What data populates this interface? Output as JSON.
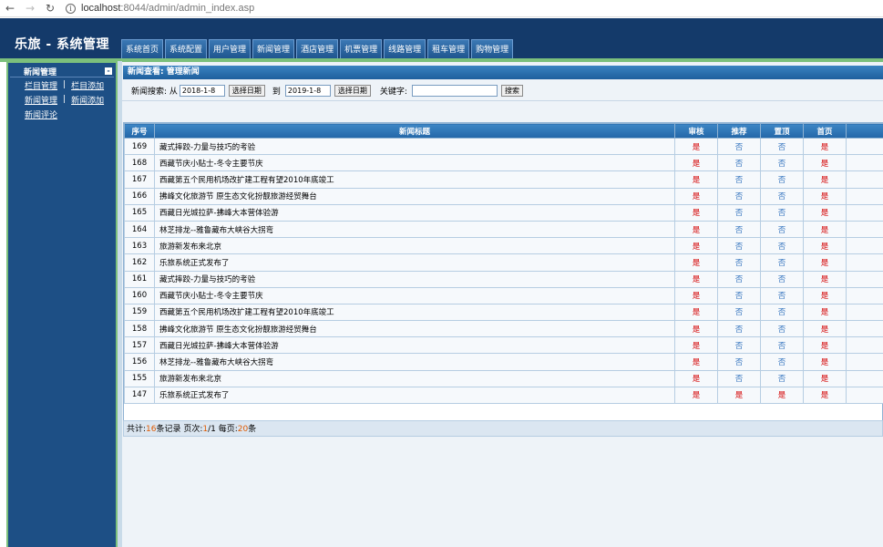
{
  "browser": {
    "url_host": "localhost",
    "url_rest": ":8044/admin/admin_index.asp"
  },
  "app": {
    "title": "乐旅 - 系统管理"
  },
  "menu": [
    "系统首页",
    "系统配置",
    "用户管理",
    "新闻管理",
    "酒店管理",
    "机票管理",
    "线路管理",
    "租车管理",
    "购物管理"
  ],
  "sidebar": {
    "section_title": "新闻管理",
    "collapse_symbol": "-",
    "rows": [
      [
        "栏目管理",
        "栏目添加"
      ],
      [
        "新闻管理",
        "新闻添加"
      ],
      [
        "新闻评论"
      ]
    ],
    "separator": "|"
  },
  "panel": {
    "title": "新闻查看: 管理新闻"
  },
  "search": {
    "label_prefix": "新闻搜索: 从",
    "date_from": "2018-1-8",
    "pick_date_label": "选择日期",
    "to_label": "到",
    "date_to": "2019-1-8",
    "keyword_label": "关键字:",
    "keyword_value": "",
    "search_button": "搜索"
  },
  "table": {
    "headers": [
      "序号",
      "新闻标题",
      "审核",
      "推荐",
      "置顶",
      "首页"
    ],
    "rows": [
      {
        "id": "169",
        "title": "藏式摔跤-力量与技巧的考验",
        "audit": "是",
        "recommend": "否",
        "top": "否",
        "home": "是"
      },
      {
        "id": "168",
        "title": "西藏节庆小贴士-冬令主要节庆",
        "audit": "是",
        "recommend": "否",
        "top": "否",
        "home": "是"
      },
      {
        "id": "167",
        "title": "西藏第五个民用机场改扩建工程有望2010年底竣工",
        "audit": "是",
        "recommend": "否",
        "top": "否",
        "home": "是"
      },
      {
        "id": "166",
        "title": "拂峰文化旅游节 原生态文化扮靓旅游经贸舞台",
        "audit": "是",
        "recommend": "否",
        "top": "否",
        "home": "是"
      },
      {
        "id": "165",
        "title": "西藏日光城拉萨-拂峰大本营体验游",
        "audit": "是",
        "recommend": "否",
        "top": "否",
        "home": "是"
      },
      {
        "id": "164",
        "title": "林芝排龙--雅鲁藏布大峡谷大拐弯",
        "audit": "是",
        "recommend": "否",
        "top": "否",
        "home": "是"
      },
      {
        "id": "163",
        "title": "旅游新发布来北京",
        "audit": "是",
        "recommend": "否",
        "top": "否",
        "home": "是"
      },
      {
        "id": "162",
        "title": "乐旅系统正式发布了",
        "audit": "是",
        "recommend": "否",
        "top": "否",
        "home": "是"
      },
      {
        "id": "161",
        "title": "藏式摔跤-力量与技巧的考验",
        "audit": "是",
        "recommend": "否",
        "top": "否",
        "home": "是"
      },
      {
        "id": "160",
        "title": "西藏节庆小贴士-冬令主要节庆",
        "audit": "是",
        "recommend": "否",
        "top": "否",
        "home": "是"
      },
      {
        "id": "159",
        "title": "西藏第五个民用机场改扩建工程有望2010年底竣工",
        "audit": "是",
        "recommend": "否",
        "top": "否",
        "home": "是"
      },
      {
        "id": "158",
        "title": "拂峰文化旅游节 原生态文化扮靓旅游经贸舞台",
        "audit": "是",
        "recommend": "否",
        "top": "否",
        "home": "是"
      },
      {
        "id": "157",
        "title": "西藏日光城拉萨-拂峰大本营体验游",
        "audit": "是",
        "recommend": "否",
        "top": "否",
        "home": "是"
      },
      {
        "id": "156",
        "title": "林芝排龙--雅鲁藏布大峡谷大拐弯",
        "audit": "是",
        "recommend": "否",
        "top": "否",
        "home": "是"
      },
      {
        "id": "155",
        "title": "旅游新发布来北京",
        "audit": "是",
        "recommend": "否",
        "top": "否",
        "home": "是"
      },
      {
        "id": "147",
        "title": "乐旅系统正式发布了",
        "audit": "是",
        "recommend": "是",
        "top": "是",
        "home": "是"
      }
    ]
  },
  "pagination": {
    "total_prefix": "共计:",
    "total": "16",
    "total_suffix": "条记录 页次:",
    "page_current": "1",
    "page_total": "/1 每页:",
    "per_page": "20",
    "per_page_suffix": "条"
  },
  "colors": {
    "header_bg": "#143a6a",
    "sidebar_bg": "#1d4f85",
    "accent_green": "#7cc07c",
    "yes": "#d40000",
    "no": "#3a78c0"
  }
}
